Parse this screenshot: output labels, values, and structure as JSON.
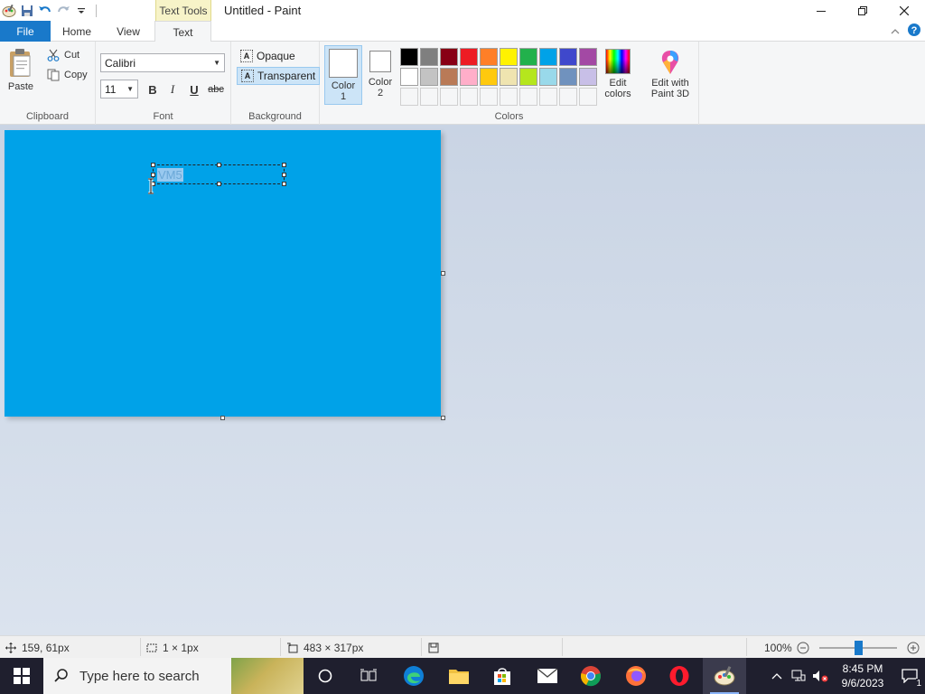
{
  "window": {
    "title": "Untitled - Paint",
    "context_tab": "Text Tools"
  },
  "tabs": [
    {
      "label": "File"
    },
    {
      "label": "Home"
    },
    {
      "label": "View"
    },
    {
      "label": "Text"
    }
  ],
  "clipboard": {
    "paste": "Paste",
    "cut": "Cut",
    "copy": "Copy",
    "label": "Clipboard"
  },
  "font": {
    "family": "Calibri",
    "size": "11",
    "bold": "B",
    "italic": "I",
    "underline": "U",
    "strike": "abc",
    "label": "Font"
  },
  "background": {
    "opaque": "Opaque",
    "transparent": "Transparent",
    "label": "Background"
  },
  "colors": {
    "color1": "Color 1",
    "color2": "Color 2",
    "edit": "Edit colors",
    "paint3d": "Edit with Paint 3D",
    "label": "Colors",
    "palette_row1": [
      "#000000",
      "#7f7f7f",
      "#880015",
      "#ed1c24",
      "#ff7f27",
      "#fff200",
      "#22b14c",
      "#00a2e8",
      "#3f48cc",
      "#a349a4"
    ],
    "palette_row2": [
      "#ffffff",
      "#c3c3c3",
      "#b97a57",
      "#ffaec9",
      "#ffc90e",
      "#efe4b0",
      "#b5e61d",
      "#99d9ea",
      "#7092be",
      "#c8bfe7"
    ]
  },
  "canvas": {
    "fill": "#00a2e8",
    "text": "VM5"
  },
  "status": {
    "position": "159, 61px",
    "selection": "1 × 1px",
    "size": "483 × 317px",
    "zoom": "100%"
  },
  "taskbar": {
    "search_placeholder": "Type here to search",
    "time": "8:45 PM",
    "date": "9/6/2023",
    "notifications": "1"
  }
}
